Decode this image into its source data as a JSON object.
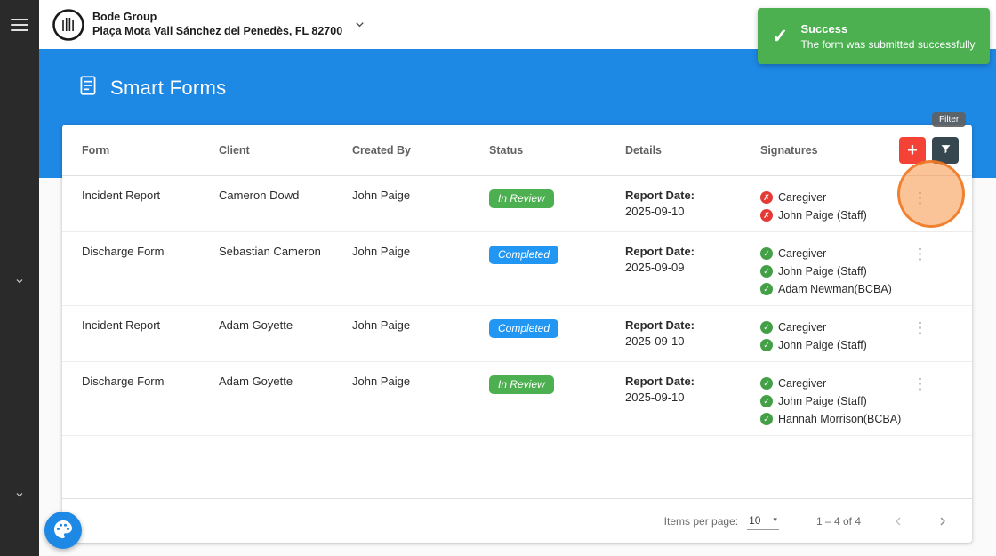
{
  "header": {
    "org_name": "Bode Group",
    "org_address": "Plaça Mota Vall Sánchez del Penedès, FL 82700"
  },
  "toast": {
    "title": "Success",
    "message": "The form was submitted successfully"
  },
  "page": {
    "title": "Smart Forms"
  },
  "table": {
    "columns": [
      "Form",
      "Client",
      "Created By",
      "Status",
      "Details",
      "Signatures"
    ],
    "filter_tooltip": "Filter",
    "rows": [
      {
        "form": "Incident Report",
        "client": "Cameron Dowd",
        "created_by": "John Paige",
        "status": "In Review",
        "details_label": "Report Date:",
        "details_date": "2025-09-10",
        "signatures": [
          {
            "name": "Caregiver",
            "signed": false
          },
          {
            "name": "John Paige (Staff)",
            "signed": false
          }
        ]
      },
      {
        "form": "Discharge Form",
        "client": "Sebastian Cameron",
        "created_by": "John Paige",
        "status": "Completed",
        "details_label": "Report Date:",
        "details_date": "2025-09-09",
        "signatures": [
          {
            "name": "Caregiver",
            "signed": true
          },
          {
            "name": "John Paige (Staff)",
            "signed": true
          },
          {
            "name": "Adam Newman(BCBA)",
            "signed": true
          }
        ]
      },
      {
        "form": "Incident Report",
        "client": "Adam Goyette",
        "created_by": "John Paige",
        "status": "Completed",
        "details_label": "Report Date:",
        "details_date": "2025-09-10",
        "signatures": [
          {
            "name": "Caregiver",
            "signed": true
          },
          {
            "name": "John Paige (Staff)",
            "signed": true
          }
        ]
      },
      {
        "form": "Discharge Form",
        "client": "Adam Goyette",
        "created_by": "John Paige",
        "status": "In Review",
        "details_label": "Report Date:",
        "details_date": "2025-09-10",
        "signatures": [
          {
            "name": "Caregiver",
            "signed": true
          },
          {
            "name": "John Paige (Staff)",
            "signed": true
          },
          {
            "name": "Hannah Morrison(BCBA)",
            "signed": true
          }
        ]
      }
    ]
  },
  "pagination": {
    "items_per_page_label": "Items per page:",
    "items_per_page_value": "10",
    "range_label": "1 – 4 of 4"
  },
  "icons": {
    "plus": "+",
    "kebab": "⋮",
    "check": "✓",
    "cross": "✗",
    "caret_down": "▾",
    "toast_check": "✓"
  },
  "colors": {
    "primary_blue": "#1e88e5",
    "toast_green": "#4caf50",
    "add_button_red": "#f44336",
    "filter_button_dark": "#37474f",
    "signed_green": "#43a047",
    "unsigned_red": "#e53935",
    "status": {
      "In Review": "#4caf50",
      "Completed": "#2196f3"
    }
  }
}
